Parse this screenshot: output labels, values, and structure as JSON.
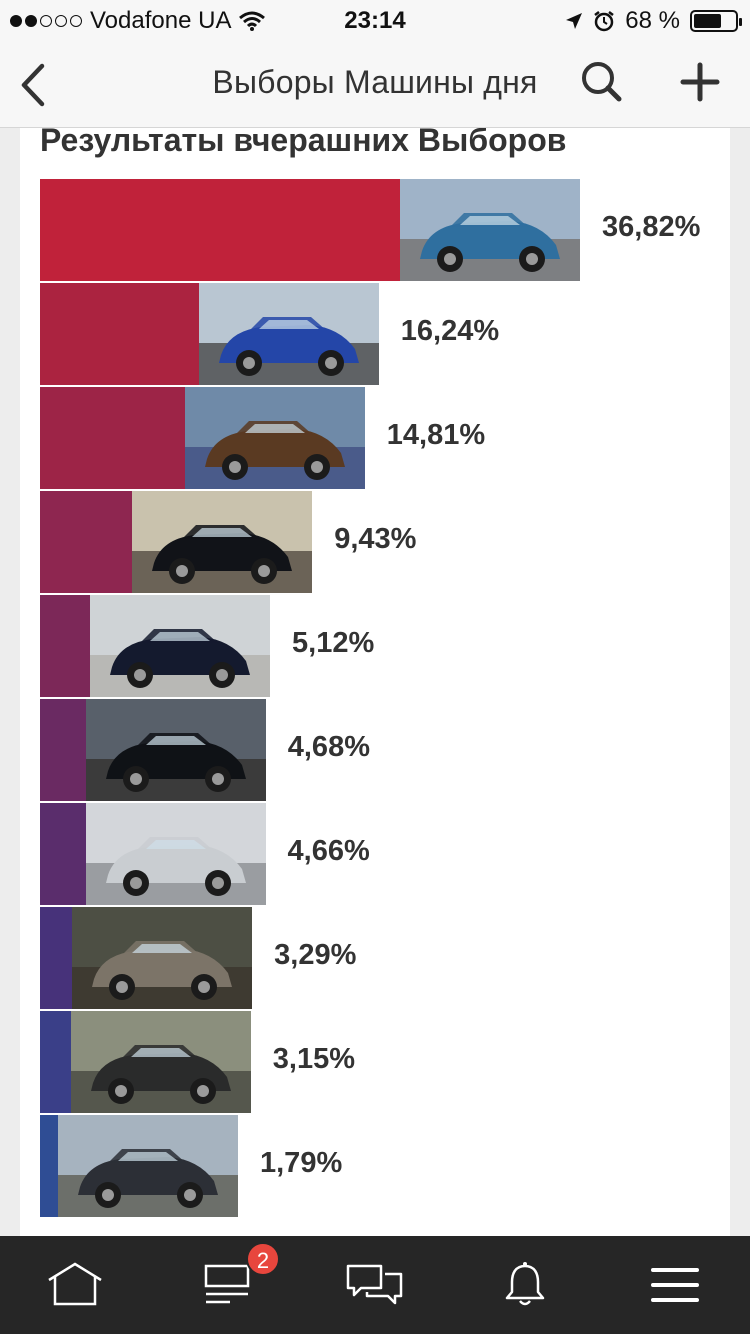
{
  "status_bar": {
    "carrier": "Vodafone UA",
    "time": "23:14",
    "battery": "68 %",
    "battery_level": 0.68,
    "icons": [
      "signal-dots-icon",
      "wifi-icon",
      "location-arrow-icon",
      "alarm-icon",
      "battery-icon"
    ]
  },
  "nav": {
    "title": "Выборы Машины дня",
    "icons": [
      "back-chevron-icon",
      "search-icon",
      "plus-icon"
    ]
  },
  "results": {
    "title": "Результаты вчерашних Выборов",
    "items": [
      {
        "percent_label": "36,82%",
        "value": 36.82,
        "color": "#c0223a",
        "photo": "blue-vintage-car-photo"
      },
      {
        "percent_label": "16,24%",
        "value": 16.24,
        "color": "#ab2340",
        "photo": "blue-sedan-photo"
      },
      {
        "percent_label": "14,81%",
        "value": 14.81,
        "color": "#9d2447",
        "photo": "car-interior-steering-wheel-photo"
      },
      {
        "percent_label": "9,43%",
        "value": 9.43,
        "color": "#8e2650",
        "photo": "black-sedan-with-woman-photo"
      },
      {
        "percent_label": "5,12%",
        "value": 5.12,
        "color": "#7c2858",
        "photo": "black-suv-photo"
      },
      {
        "percent_label": "4,68%",
        "value": 4.68,
        "color": "#6a2a62",
        "photo": "black-suv-night-photo"
      },
      {
        "percent_label": "4,66%",
        "value": 4.66,
        "color": "#5a2d6c",
        "photo": "silver-coupe-wheel-photo"
      },
      {
        "percent_label": "3,29%",
        "value": 3.29,
        "color": "#47327a",
        "photo": "grey-sedan-photo"
      },
      {
        "percent_label": "3,15%",
        "value": 3.15,
        "color": "#3a3f88",
        "photo": "dark-minivan-photo"
      },
      {
        "percent_label": "1,79%",
        "value": 1.79,
        "color": "#2f4d94",
        "photo": "dark-hatchback-lakeside-photo"
      }
    ]
  },
  "tab_bar": {
    "tabs": [
      {
        "name": "home",
        "icon": "home-icon"
      },
      {
        "name": "feed",
        "icon": "feed-icon",
        "badge": "2"
      },
      {
        "name": "messages",
        "icon": "chat-icon"
      },
      {
        "name": "notifications",
        "icon": "bell-icon"
      },
      {
        "name": "menu",
        "icon": "hamburger-menu-icon"
      }
    ],
    "badge_color": "#e8463d"
  }
}
